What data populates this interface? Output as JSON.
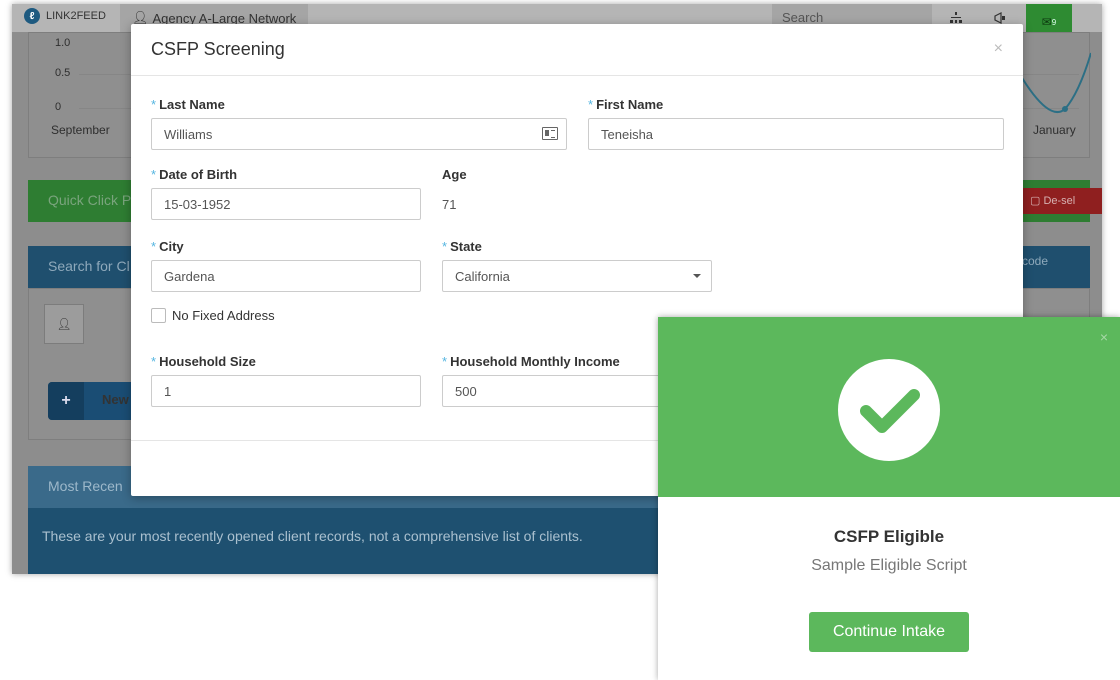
{
  "app": {
    "brand": "LINK2FEED",
    "agency": "Agency A-Large Network",
    "search_placeholder": "Search",
    "mail_count": "9",
    "chart": {
      "y_ticks": [
        "1.0",
        "0.5",
        "0"
      ],
      "x_ticks": [
        "September",
        "January"
      ]
    },
    "quick_click_label": "Quick Click P",
    "deselect_label": "De-sel",
    "search_header": "Search for Cl",
    "barcode_label": "code",
    "new_button_label": "New",
    "recent_header": "Most Recen",
    "recent_note": "These are your most recently opened client records, not a comprehensive list of clients."
  },
  "modal": {
    "title": "CSFP Screening",
    "close": "×",
    "required_marker": "*",
    "last_name": {
      "label": "Last Name",
      "value": "Williams"
    },
    "first_name": {
      "label": "First Name",
      "value": "Teneisha"
    },
    "dob": {
      "label": "Date of Birth",
      "value": "15-03-1952"
    },
    "age": {
      "label": "Age",
      "value": "71"
    },
    "city": {
      "label": "City",
      "value": "Gardena"
    },
    "state": {
      "label": "State",
      "value": "California"
    },
    "no_fixed_address": {
      "label": "No Fixed Address",
      "checked": false
    },
    "household_size": {
      "label": "Household Size",
      "value": "1"
    },
    "household_income": {
      "label": "Household Monthly Income",
      "value": "500"
    }
  },
  "popup": {
    "close": "×",
    "title": "CSFP Eligible",
    "subtitle": "Sample Eligible Script",
    "continue_label": "Continue Intake",
    "color": "#5cb85c"
  }
}
